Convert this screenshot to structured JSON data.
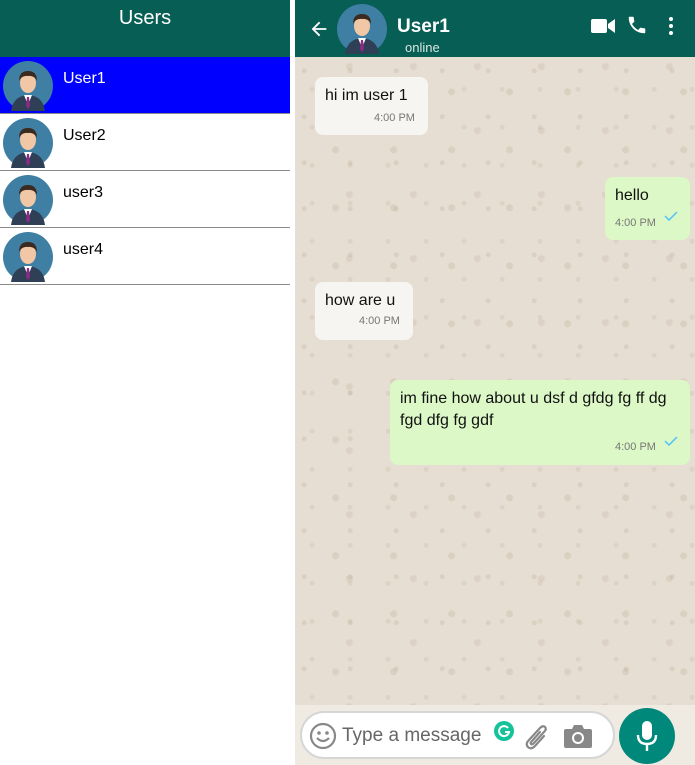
{
  "sidebar": {
    "title": "Users",
    "users": [
      {
        "name": "User1",
        "active": true
      },
      {
        "name": "User2",
        "active": false
      },
      {
        "name": "user3",
        "active": false
      },
      {
        "name": "user4",
        "active": false
      }
    ]
  },
  "chat": {
    "contact_name": "User1",
    "status": "online",
    "messages": [
      {
        "direction": "in",
        "text": "hi im user 1",
        "time": "4:00 PM"
      },
      {
        "direction": "out",
        "text": "hello",
        "time": "4:00 PM"
      },
      {
        "direction": "in",
        "text": "how are u",
        "time": "4:00 PM"
      },
      {
        "direction": "out",
        "text": "im fine how about u dsf d gfdg fg ff dg fgd dfg fg gdf",
        "time": "4:00 PM"
      }
    ],
    "input": {
      "placeholder": "Type a message",
      "value": ""
    }
  },
  "colors": {
    "header": "#075e54",
    "active_user": "#0000ff",
    "incoming_bubble": "#f6f5f2",
    "outgoing_bubble": "#dcf8c6",
    "mic_button": "#00897b",
    "read_check": "#4fc3f7"
  },
  "icons": [
    "back-arrow-icon",
    "video-call-icon",
    "phone-icon",
    "more-vert-icon",
    "emoji-icon",
    "grammarly-icon",
    "attach-icon",
    "camera-icon",
    "mic-icon",
    "avatar"
  ]
}
